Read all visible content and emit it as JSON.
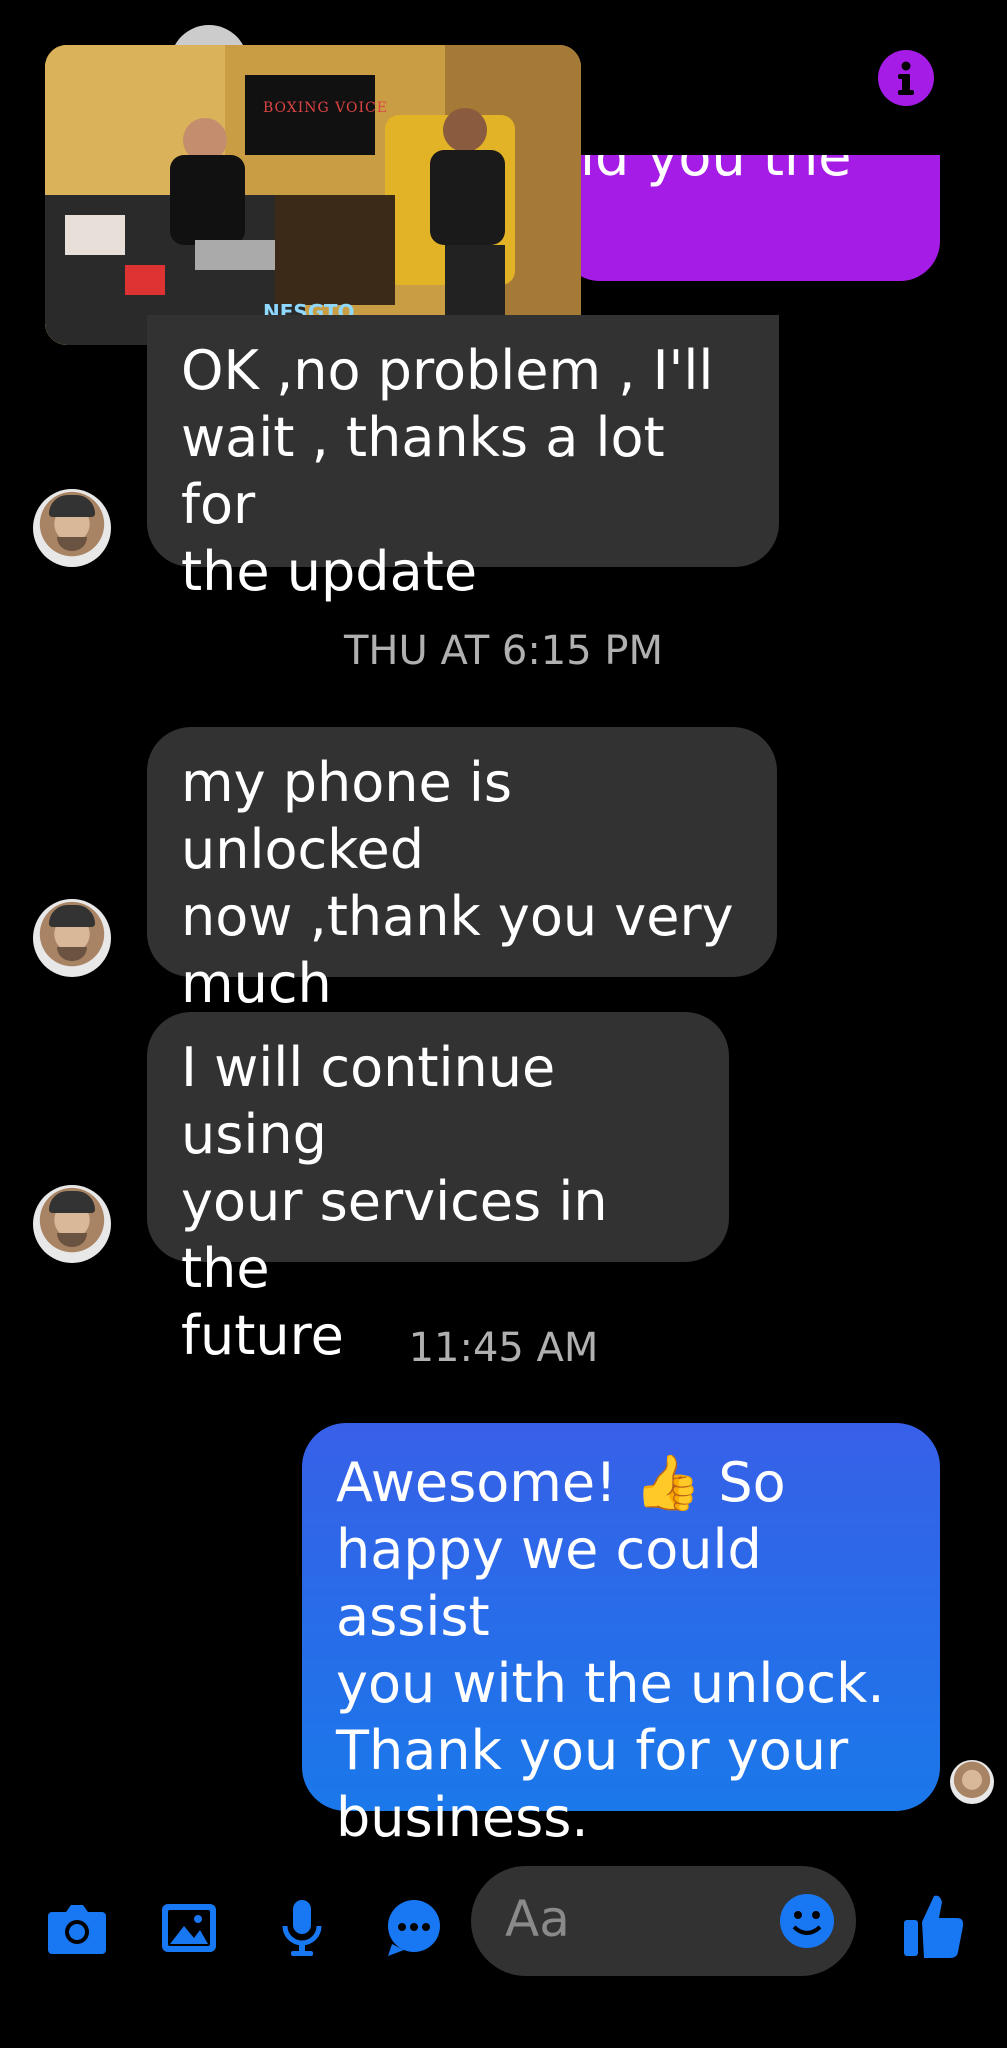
{
  "header": {
    "partial_message": "ıd you the",
    "info_icon": "info-icon"
  },
  "video_overlay": {
    "banner_text": "BOXING VOICE",
    "watermark": "NESGTO"
  },
  "messages": [
    {
      "id": "m1",
      "direction": "incoming",
      "lines": [
        "OK ,no problem , I'll",
        "wait ,  thanks a lot for",
        "the update"
      ]
    },
    {
      "id": "ts1",
      "type": "timestamp",
      "text": "THU AT 6:15 PM"
    },
    {
      "id": "m2",
      "direction": "incoming",
      "lines": [
        "my phone is unlocked",
        "now ,thank you very",
        "much"
      ]
    },
    {
      "id": "m3",
      "direction": "incoming",
      "lines": [
        "I will continue using",
        "your services in the",
        "future"
      ]
    },
    {
      "id": "ts2",
      "type": "timestamp",
      "text": "11:45 AM"
    },
    {
      "id": "m4",
      "direction": "outgoing",
      "lines": [
        "Awesome! 👍 So",
        "happy we could assist",
        "you with the unlock.",
        "Thank you for your",
        "business."
      ]
    }
  ],
  "composer": {
    "placeholder": "Aa",
    "icons": [
      "camera-icon",
      "gallery-icon",
      "microphone-icon",
      "chat-icon",
      "emoji-icon",
      "thumbs-up-icon"
    ]
  },
  "colors": {
    "accent": "#1877f2",
    "sent_bubble_top": "#3760e8",
    "sent_bubble_bottom": "#1a78ea",
    "received_bubble": "#323232",
    "purple_bubble": "#a51ce6"
  }
}
